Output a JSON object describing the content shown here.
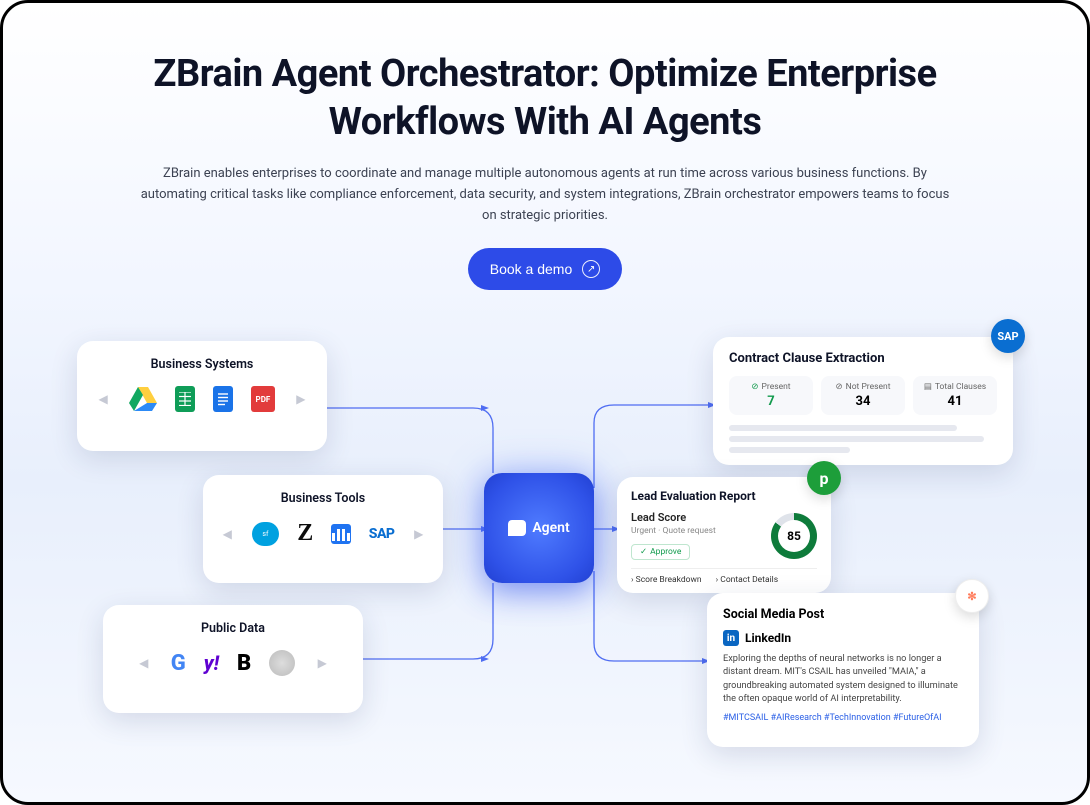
{
  "hero": {
    "title": "ZBrain Agent Orchestrator: Optimize Enterprise Workflows With AI Agents",
    "subtitle": "ZBrain enables enterprises to coordinate and manage multiple autonomous agents at run time across various business functions. By automating critical tasks like compliance enforcement, data security, and system integrations, ZBrain orchestrator empowers teams to focus on strategic priorities.",
    "cta_label": "Book a demo"
  },
  "agent": {
    "label": "Agent"
  },
  "left_cards": {
    "business_systems": {
      "title": "Business Systems",
      "icons": [
        "google-drive-icon",
        "google-sheets-icon",
        "google-docs-icon",
        "pdf-icon"
      ]
    },
    "business_tools": {
      "title": "Business Tools",
      "icons": [
        "salesforce-icon",
        "zendesk-icon",
        "intercom-icon",
        "sap-icon"
      ]
    },
    "public_data": {
      "title": "Public Data",
      "icons": [
        "google-icon",
        "yahoo-icon",
        "bing-icon",
        "wikipedia-icon"
      ]
    }
  },
  "cce": {
    "title": "Contract Clause Extraction",
    "badge": "SAP",
    "stats": [
      {
        "label": "Present",
        "value": "7",
        "tone": "green"
      },
      {
        "label": "Not Present",
        "value": "34",
        "tone": "default"
      },
      {
        "label": "Total Clauses",
        "value": "41",
        "tone": "default"
      }
    ]
  },
  "ler": {
    "title": "Lead Evaluation Report",
    "badge": "p",
    "subtitle": "Lead Score",
    "meta": "Urgent · Quote request",
    "approve": "Approve",
    "score": "85",
    "links": [
      "Score Breakdown",
      "Contact Details"
    ]
  },
  "smp": {
    "title": "Social Media Post",
    "badge": "✼",
    "platform": "LinkedIn",
    "body": "Exploring the depths of neural networks is no longer a distant dream. MIT's CSAIL has unveiled \"MAIA,\" a groundbreaking automated system designed to illuminate the often opaque world of AI interpretability.",
    "tags": "#MITCSAIL #AIResearch #TechInnovation #FutureOfAI"
  }
}
